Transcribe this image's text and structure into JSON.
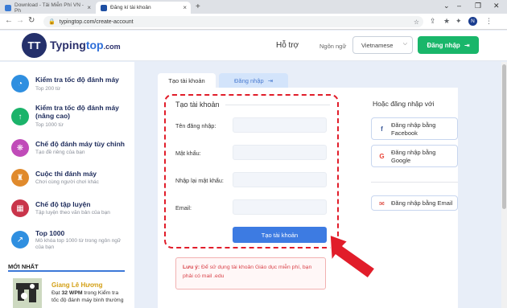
{
  "browser": {
    "tabs": [
      {
        "title": "Download - Tải Miễn Phí VN - Ph"
      },
      {
        "title": "Đăng kí tài khoản"
      }
    ],
    "url": "typingtop.com/create-account",
    "profile_initial": "N"
  },
  "header": {
    "logo_mark": "TT",
    "logo_name": "Typing",
    "logo_name_accent": "top",
    "logo_domain": ".com",
    "support": "Hỗ trợ",
    "language_label": "Ngôn ngữ",
    "language_value": "Vietnamese",
    "login_button": "Đăng nhập"
  },
  "sidebar": {
    "items": [
      {
        "title": "Kiểm tra tốc độ đánh máy",
        "sub": "Top 200 từ",
        "color": "#2f8fe0",
        "icon": "speedometer-icon"
      },
      {
        "title": "Kiểm tra tốc độ đánh máy (nâng cao)",
        "sub": "Top 1000 từ",
        "color": "#1bb36a",
        "icon": "arrow-up-icon"
      },
      {
        "title": "Chế độ đánh máy tùy chỉnh",
        "sub": "Tạo đề riêng của bạn",
        "color": "#c04bb9",
        "icon": "palette-icon"
      },
      {
        "title": "Cuộc thi đánh máy",
        "sub": "Chơi cùng người chơi khác",
        "color": "#e08a2c",
        "icon": "trophy-icon"
      },
      {
        "title": "Chế độ tập luyện",
        "sub": "Tập luyện theo văn bản của bạn",
        "color": "#c9344a",
        "icon": "keyboard-icon"
      },
      {
        "title": "Top 1000",
        "sub": "Mô khóa top 1000 từ trong ngôn ngữ của bạn",
        "color": "#2f8fe0",
        "icon": "chart-icon"
      }
    ],
    "newest_label": "MỚI NHẤT",
    "news": {
      "name": "Giang Lê Hương",
      "text_prefix": "Đạt ",
      "text_bold": "32 WPM",
      "text_suffix": " trong Kiểm tra tốc độ đánh máy bình thường"
    }
  },
  "main": {
    "tab_create": "Tạo tài khoản",
    "tab_login": "Đăng nhập",
    "form_title": "Tạo tài khoản",
    "fields": [
      {
        "label": "Tên đăng nhập:"
      },
      {
        "label": "Mật khẩu:"
      },
      {
        "label": "Nhập lại mật khẩu:"
      },
      {
        "label": "Email:"
      }
    ],
    "submit": "Tạo tài khoản",
    "note_prefix": "Lưu ý:",
    "note_text": " Để sử dụng tài khoản Giáo dục miễn phí, bạn phải có mail .edu",
    "or_title": "Hoặc đăng nhập với",
    "social": [
      {
        "label": "Đăng nhập bằng Facebook",
        "icon": "facebook-icon",
        "glyph": "f",
        "color": "#3b5998"
      },
      {
        "label": "Đăng nhập bằng Google",
        "icon": "google-icon",
        "glyph": "G",
        "color": "#ea4335"
      },
      {
        "label": "Đăng nhập bằng Email",
        "icon": "email-icon",
        "glyph": "✉",
        "color": "#d93025"
      }
    ]
  },
  "colors": {
    "accent_green": "#19b66a",
    "accent_blue": "#3d7be2",
    "highlight_red": "#e11d2a"
  }
}
